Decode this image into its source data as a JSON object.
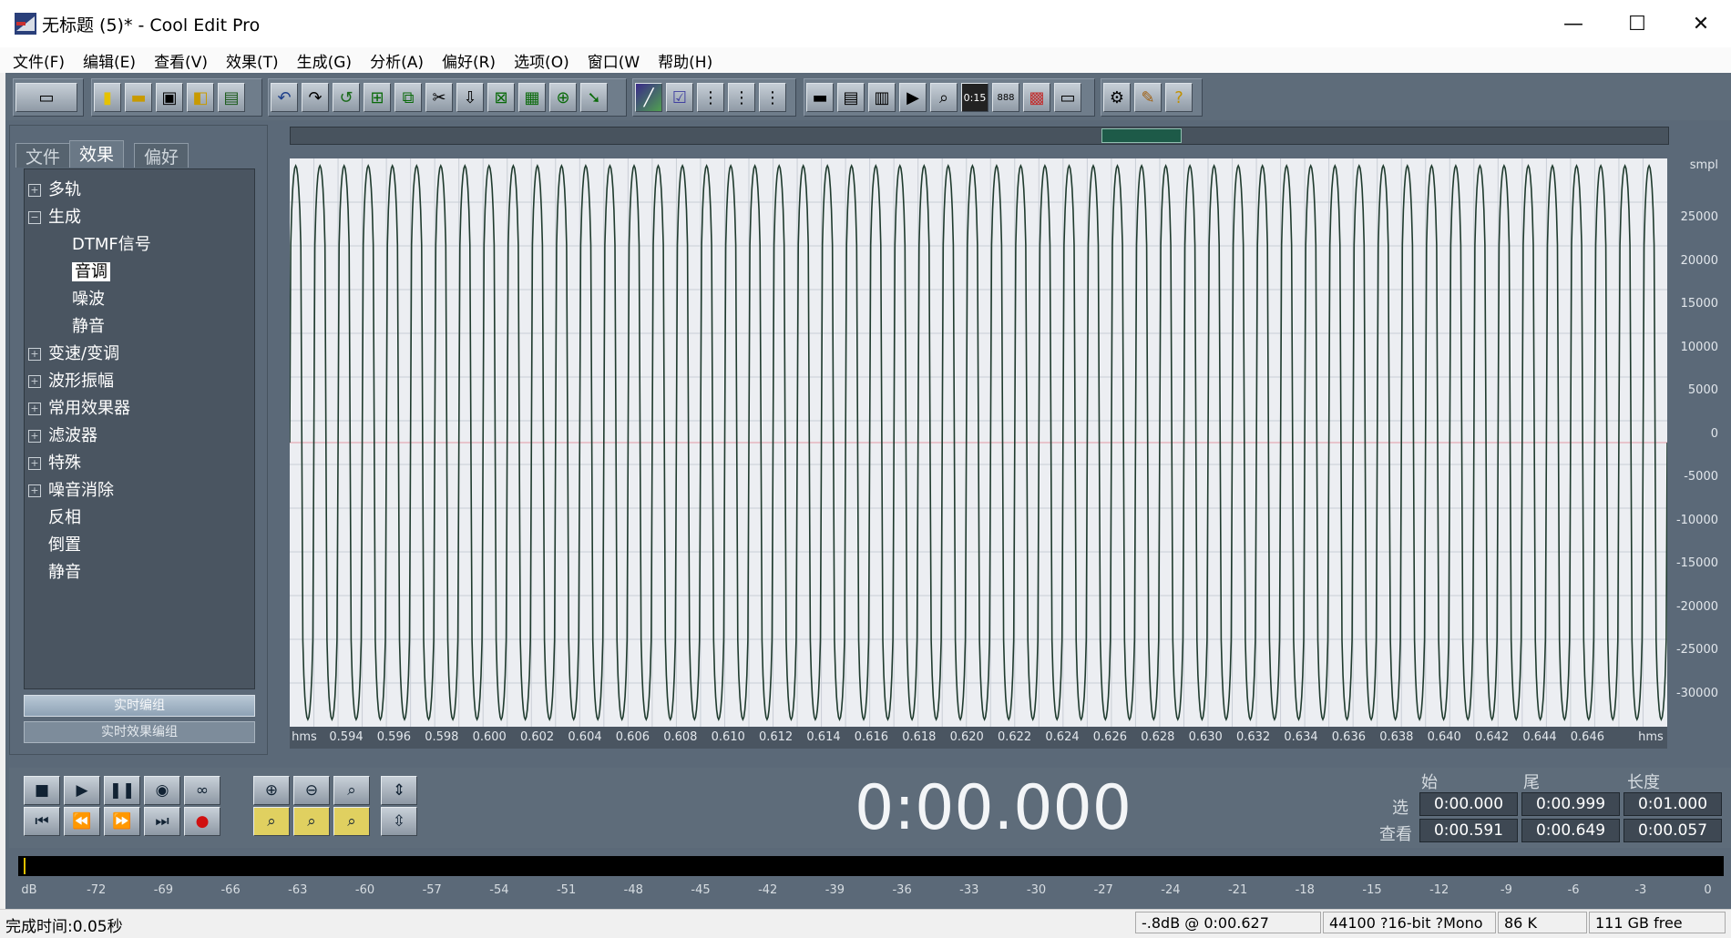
{
  "window": {
    "title": "无标题 (5)* - Cool Edit Pro",
    "minimize_glyph": "—",
    "maximize_glyph": "☐",
    "close_glyph": "✕"
  },
  "menu": [
    "文件(F)",
    "编辑(E)",
    "查看(V)",
    "效果(T)",
    "生成(G)",
    "分析(A)",
    "偏好(R)",
    "选项(O)",
    "窗口(W",
    "帮助(H)"
  ],
  "toolbar_groups": [
    [
      "multitrack-icon"
    ],
    [
      "new-file-icon",
      "open-folder-icon",
      "save-icon",
      "save-all-icon",
      "close-file-icon"
    ],
    [
      "undo-icon",
      "redo-icon",
      "repeat-icon",
      "trim-icon",
      "copy-icon",
      "cut-icon",
      "paste-icon",
      "paste-new-icon",
      "mix-paste-icon",
      "mix-icon",
      "convert-icon"
    ],
    [
      "spectral-icon",
      "check-icon",
      "grid-a-icon",
      "grid-b-icon",
      "grid-c-icon"
    ],
    [
      "window-a-icon",
      "window-b-icon",
      "window-c-icon",
      "play-panel-icon",
      "zoom-panel-icon",
      "time-icon",
      "info-icon",
      "level-icon",
      "status-icon"
    ],
    [
      "settings-icon",
      "script-icon",
      "help-icon"
    ]
  ],
  "left_panel": {
    "tabs": [
      "文件",
      "效果",
      "偏好"
    ],
    "tree": [
      {
        "label": "多轨",
        "level": 0,
        "expander": "+"
      },
      {
        "label": "生成",
        "level": 0,
        "expander": "−"
      },
      {
        "label": "DTMF信号",
        "level": 1
      },
      {
        "label": "音调",
        "level": 1,
        "selected": true
      },
      {
        "label": "噪波",
        "level": 1
      },
      {
        "label": "静音",
        "level": 1
      },
      {
        "label": "变速/变调",
        "level": 0,
        "expander": "+"
      },
      {
        "label": "波形振幅",
        "level": 0,
        "expander": "+"
      },
      {
        "label": "常用效果器",
        "level": 0,
        "expander": "+"
      },
      {
        "label": "滤波器",
        "level": 0,
        "expander": "+"
      },
      {
        "label": "特殊",
        "level": 0,
        "expander": "+"
      },
      {
        "label": "噪音消除",
        "level": 0,
        "expander": "+"
      },
      {
        "label": "反相",
        "level": 0
      },
      {
        "label": "倒置",
        "level": 0
      },
      {
        "label": "静音",
        "level": 0
      }
    ],
    "buttons": [
      "实时编组",
      "实时效果编组"
    ]
  },
  "waveform": {
    "y_unit": "smpl",
    "y_ticks": [
      "25000",
      "20000",
      "15000",
      "10000",
      "5000",
      "0",
      "-5000",
      "-10000",
      "-15000",
      "-20000",
      "-25000",
      "-30000"
    ],
    "x_unit": "hms",
    "x_ticks": [
      "0.594",
      "0.596",
      "0.598",
      "0.600",
      "0.602",
      "0.604",
      "0.606",
      "0.608",
      "0.610",
      "0.612",
      "0.614",
      "0.616",
      "0.618",
      "0.620",
      "0.622",
      "0.624",
      "0.626",
      "0.628",
      "0.630",
      "0.632",
      "0.634",
      "0.636",
      "0.638",
      "0.640",
      "0.642",
      "0.644",
      "0.646"
    ],
    "cycles": 57,
    "wave_color": "#1f3b2e",
    "background": "#eceef2"
  },
  "transport": {
    "time": "0:00.000",
    "headers": [
      "始",
      "尾",
      "长度"
    ],
    "rows": [
      {
        "label": "选",
        "values": [
          "0:00.000",
          "0:00.999",
          "0:01.000"
        ]
      },
      {
        "label": "查看",
        "values": [
          "0:00.591",
          "0:00.649",
          "0:00.057"
        ]
      }
    ]
  },
  "meter": {
    "ticks": [
      "dB",
      "-72",
      "-69",
      "-66",
      "-63",
      "-60",
      "-57",
      "-54",
      "-51",
      "-48",
      "-45",
      "-42",
      "-39",
      "-36",
      "-33",
      "-30",
      "-27",
      "-24",
      "-21",
      "-18",
      "-15",
      "-12",
      "-9",
      "-6",
      "-3",
      "0"
    ]
  },
  "status": {
    "left": "完成时间:0.05秒",
    "level": "-.8dB @  0:00.627",
    "format": "44100 ?16-bit ?Mono",
    "size": "86 K",
    "free": "111 GB free"
  }
}
